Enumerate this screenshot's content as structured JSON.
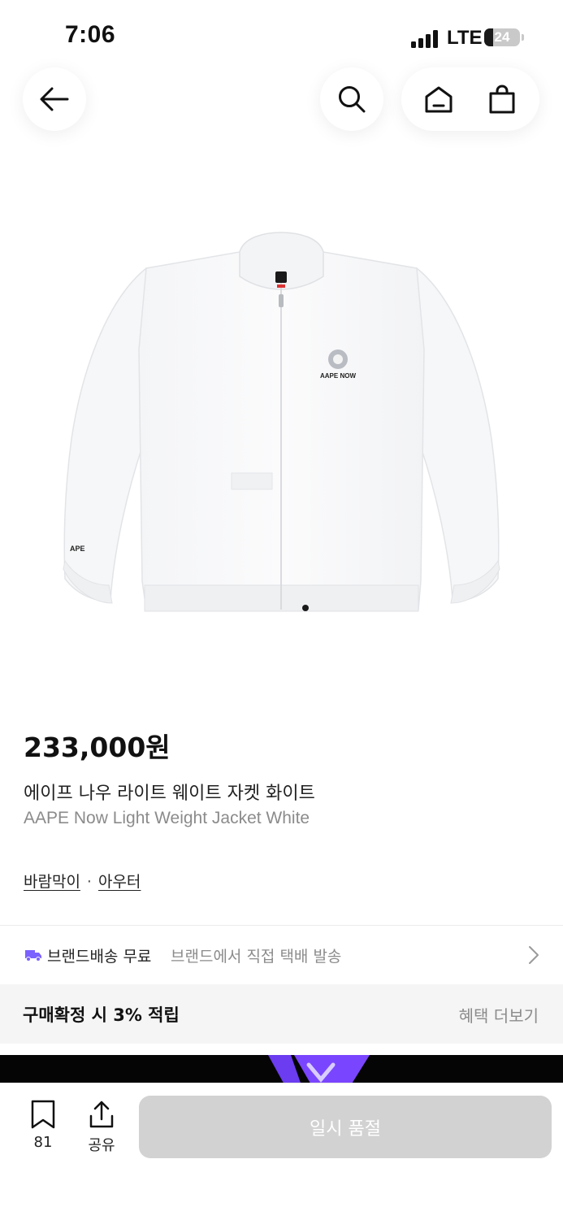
{
  "status_bar": {
    "time": "7:06",
    "network": "LTE",
    "battery": "24"
  },
  "product": {
    "price": "233,000원",
    "name_ko": "에이프 나우 라이트 웨이트 자켓 화이트",
    "name_en": "AAPE Now Light Weight Jacket White",
    "image": {
      "chest_logo_text": "AAPE NOW",
      "sleeve_text": "APE"
    }
  },
  "categories": [
    "바람막이",
    "아우터"
  ],
  "category_separator": "·",
  "shipping": {
    "label": "브랜드배송 무료",
    "sub": "브랜드에서 직접 택배 발송",
    "accent": "#7b61ff"
  },
  "benefit": {
    "text": "구매확정 시 3% 적립",
    "link": "혜택 더보기"
  },
  "bottom_bar": {
    "bookmark_count": "81",
    "share_label": "공유",
    "buy_label": "일시 품절"
  },
  "icons": [
    "back-arrow-icon",
    "search-icon",
    "home-icon",
    "shopping-bag-icon",
    "truck-icon",
    "chevron-right-icon",
    "bookmark-icon",
    "share-icon"
  ]
}
